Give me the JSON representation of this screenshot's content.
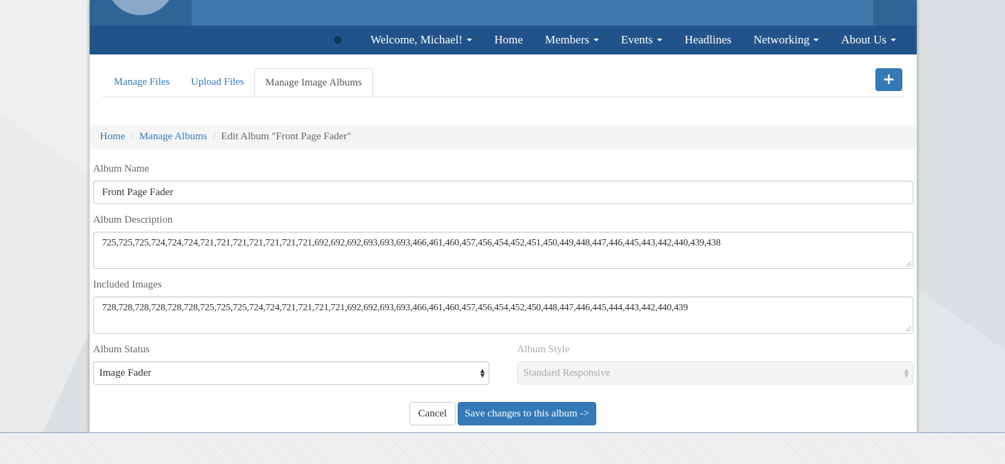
{
  "nav": {
    "welcome": "Welcome, Michael!",
    "items": [
      {
        "label": "Home"
      },
      {
        "label": "Members"
      },
      {
        "label": "Events"
      },
      {
        "label": "Headlines"
      },
      {
        "label": "Networking"
      },
      {
        "label": "About Us"
      }
    ]
  },
  "tabs": {
    "manage_files": "Manage Files",
    "upload_files": "Upload Files",
    "manage_image_albums": "Manage Image Albums",
    "add_icon": "+"
  },
  "breadcrumb": {
    "home": "Home",
    "manage_albums": "Manage Albums",
    "current": "Edit Album \"Front Page Fader\""
  },
  "form": {
    "album_name_label": "Album Name",
    "album_name_value": "Front Page Fader",
    "album_description_label": "Album Description",
    "album_description_value": "725,725,725,724,724,724,721,721,721,721,721,721,721,692,692,692,693,693,693,466,461,460,457,456,454,452,451,450,449,448,447,446,445,443,442,440,439,438",
    "included_images_label": "Included Images",
    "included_images_value": "728,728,728,728,728,728,725,725,725,724,724,721,721,721,721,692,692,693,693,466,461,460,457,456,454,452,450,448,447,446,445,444,443,442,440,439",
    "album_status_label": "Album Status",
    "album_status_value": "Image Fader",
    "album_style_label": "Album Style",
    "album_style_value": "Standard Responsive",
    "cancel_label": "Cancel",
    "save_label": "Save changes to this album ->"
  },
  "colors": {
    "banner": "#3f78ac",
    "navbar": "#21538a",
    "primary": "#337ab7",
    "link": "#337ab7"
  },
  "icons": [
    "spinner-icon",
    "caret-down-icon",
    "plus-icon",
    "select-arrows-icon",
    "resize-handle-icon"
  ]
}
